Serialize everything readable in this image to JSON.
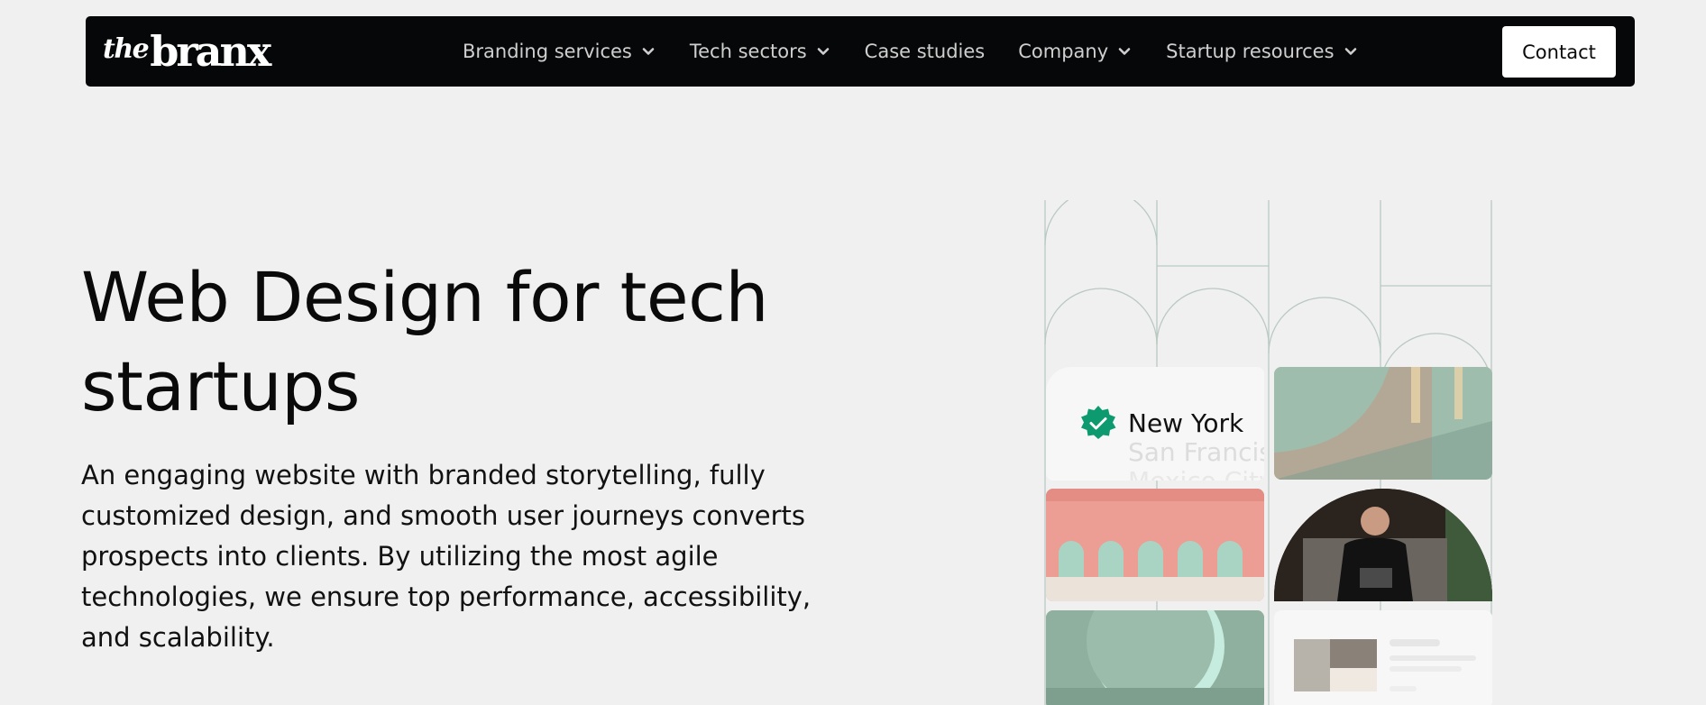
{
  "brand": {
    "logo_prefix": "the",
    "logo_name": "branx"
  },
  "nav": {
    "items": [
      {
        "label": "Branding services",
        "dropdown": true
      },
      {
        "label": "Tech sectors",
        "dropdown": true
      },
      {
        "label": "Case studies",
        "dropdown": false
      },
      {
        "label": "Company",
        "dropdown": true
      },
      {
        "label": "Startup resources",
        "dropdown": true
      }
    ],
    "contact_label": "Contact"
  },
  "hero": {
    "title": "Web Design for tech startups",
    "description": "An engaging website with branded storytelling, fully customized design, and smooth user journeys converts prospects into clients. By utilizing the most agile technologies, we ensure top performance, accessibility, and scalability."
  },
  "visual": {
    "locations": [
      "New York",
      "San Francisco",
      "Mexico City"
    ]
  },
  "colors": {
    "nav_background": "#060708",
    "page_background": "#f0f0f0",
    "badge_green": "#0e9a6f",
    "accent_pink": "#ec9e94",
    "accent_sage": "#9dbfae"
  }
}
